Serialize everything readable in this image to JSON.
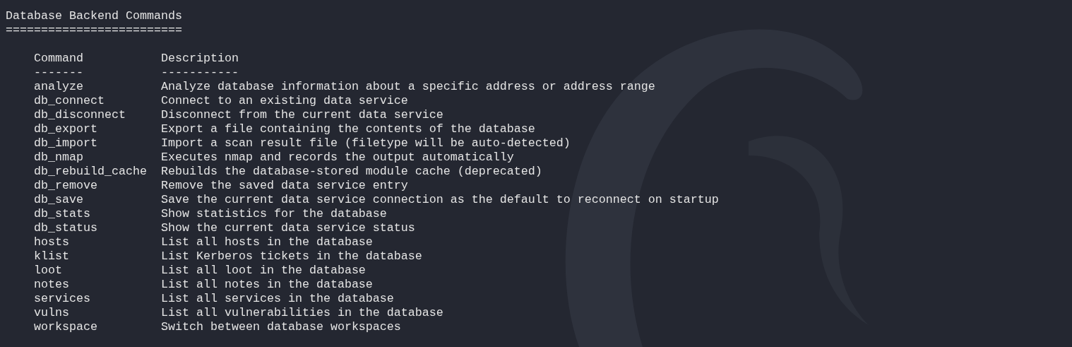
{
  "title": "Database Backend Commands",
  "title_underline": "=========================",
  "columns": [
    {
      "label": "Command",
      "underline": "-------"
    },
    {
      "label": "Description",
      "underline": "-----------"
    }
  ],
  "rows": [
    {
      "command": "analyze",
      "description": "Analyze database information about a specific address or address range"
    },
    {
      "command": "db_connect",
      "description": "Connect to an existing data service"
    },
    {
      "command": "db_disconnect",
      "description": "Disconnect from the current data service"
    },
    {
      "command": "db_export",
      "description": "Export a file containing the contents of the database"
    },
    {
      "command": "db_import",
      "description": "Import a scan result file (filetype will be auto-detected)"
    },
    {
      "command": "db_nmap",
      "description": "Executes nmap and records the output automatically"
    },
    {
      "command": "db_rebuild_cache",
      "description": "Rebuilds the database-stored module cache (deprecated)"
    },
    {
      "command": "db_remove",
      "description": "Remove the saved data service entry"
    },
    {
      "command": "db_save",
      "description": "Save the current data service connection as the default to reconnect on startup"
    },
    {
      "command": "db_stats",
      "description": "Show statistics for the database"
    },
    {
      "command": "db_status",
      "description": "Show the current data service status"
    },
    {
      "command": "hosts",
      "description": "List all hosts in the database"
    },
    {
      "command": "klist",
      "description": "List Kerberos tickets in the database"
    },
    {
      "command": "loot",
      "description": "List all loot in the database"
    },
    {
      "command": "notes",
      "description": "List all notes in the database"
    },
    {
      "command": "services",
      "description": "List all services in the database"
    },
    {
      "command": "vulns",
      "description": "List all vulnerabilities in the database"
    },
    {
      "command": "workspace",
      "description": "Switch between database workspaces"
    }
  ]
}
